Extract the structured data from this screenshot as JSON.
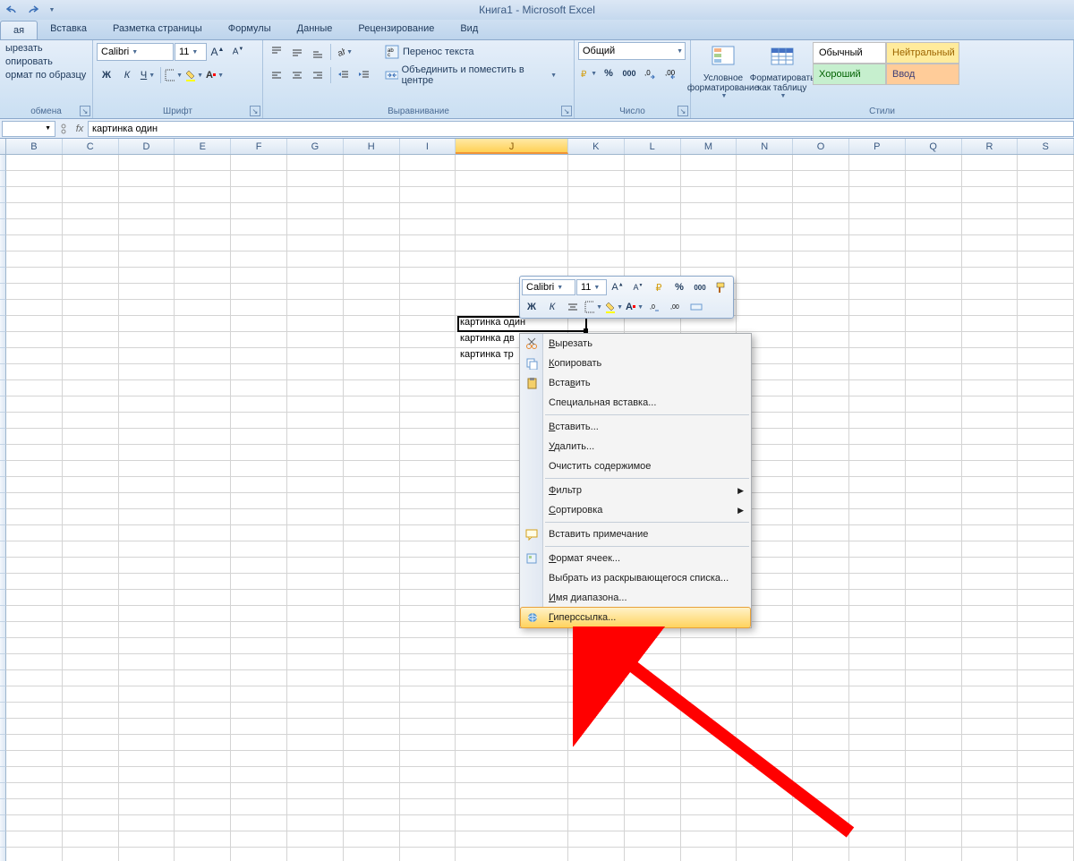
{
  "app_title": "Книга1 - Microsoft Excel",
  "qat": {
    "undo": "↶",
    "redo": "↷"
  },
  "tabs": [
    "ая",
    "Вставка",
    "Разметка страницы",
    "Формулы",
    "Данные",
    "Рецензирование",
    "Вид"
  ],
  "active_tab_index": 0,
  "clipboard": {
    "cut": "ырезать",
    "copy": "опировать",
    "paste_format": "ормат по образцу",
    "group_label": "обмена"
  },
  "font": {
    "name": "Calibri",
    "size": "11",
    "bold": "Ж",
    "italic": "К",
    "underline": "Ч",
    "group_label": "Шрифт"
  },
  "alignment": {
    "wrap": "Перенос текста",
    "merge": "Объединить и поместить в центре",
    "group_label": "Выравнивание"
  },
  "number": {
    "format": "Общий",
    "group_label": "Число"
  },
  "styles": {
    "cond": "Условное форматирование",
    "table": "Форматировать как таблицу",
    "normal": "Обычный",
    "neutral": "Нейтральный",
    "good": "Хороший",
    "input": "Ввод",
    "group_label": "Стили"
  },
  "namebox": "",
  "formula": "картинка один",
  "columns": [
    "B",
    "C",
    "D",
    "E",
    "F",
    "G",
    "H",
    "I",
    "J",
    "K",
    "L",
    "M",
    "N",
    "O",
    "P",
    "Q",
    "R",
    "S"
  ],
  "selected_col": "J",
  "cells": {
    "j_row1": "картинка один",
    "j_row2": "картинка дв",
    "j_row3": "картинка тр"
  },
  "minibar": {
    "font": "Calibri",
    "size": "11",
    "percent": "%",
    "thousands": "000"
  },
  "context_menu": [
    {
      "label": "Вырезать",
      "accel": "В",
      "icon": "cut"
    },
    {
      "label": "Копировать",
      "accel": "К",
      "icon": "copy"
    },
    {
      "label": "Вставить",
      "accel": "в",
      "icon": "paste"
    },
    {
      "label": "Специальная вставка...",
      "accel": ""
    },
    {
      "sep": true
    },
    {
      "label": "Вставить...",
      "accel": "В"
    },
    {
      "label": "Удалить...",
      "accel": "У"
    },
    {
      "label": "Очистить содержимое",
      "accel": ""
    },
    {
      "sep": true
    },
    {
      "label": "Фильтр",
      "accel": "Ф",
      "submenu": true
    },
    {
      "label": "Сортировка",
      "accel": "С",
      "submenu": true
    },
    {
      "sep": true
    },
    {
      "label": "Вставить примечание",
      "accel": "",
      "icon": "comment"
    },
    {
      "sep": true
    },
    {
      "label": "Формат ячеек...",
      "accel": "Ф",
      "icon": "format"
    },
    {
      "label": "Выбрать из раскрывающегося списка...",
      "accel": ""
    },
    {
      "label": "Имя диапазона...",
      "accel": "И"
    },
    {
      "label": "Гиперссылка...",
      "accel": "Г",
      "icon": "link",
      "highlighted": true
    }
  ]
}
